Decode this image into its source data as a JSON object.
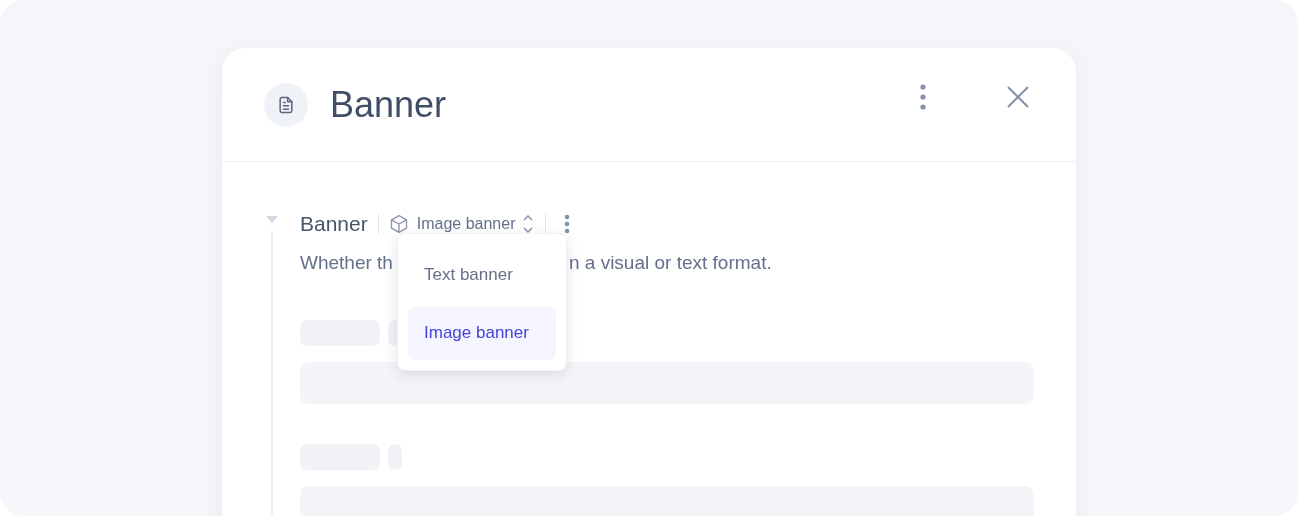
{
  "dialog": {
    "title": "Banner"
  },
  "field": {
    "label": "Banner",
    "expanded": true,
    "type_value": "Image banner",
    "description_start": "Whether th",
    "description_end": "n a visual or text format."
  },
  "dropdown": {
    "options": [
      {
        "label": "Text banner",
        "selected": false
      },
      {
        "label": "Image banner",
        "selected": true
      }
    ]
  }
}
